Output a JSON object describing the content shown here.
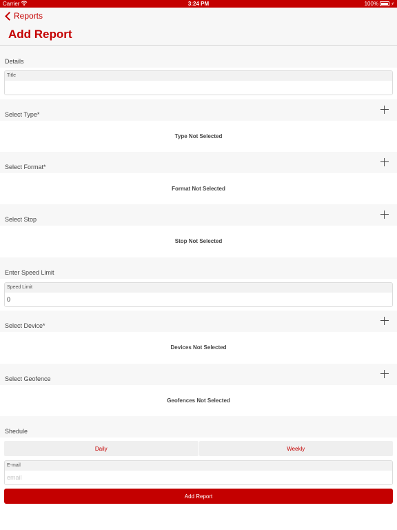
{
  "status_bar": {
    "carrier": "Carrier",
    "time": "3:24 PM",
    "battery": "100%"
  },
  "nav": {
    "back_label": "Reports",
    "title": "Add Report"
  },
  "details": {
    "header": "Details",
    "title_label": "Title",
    "title_value": ""
  },
  "type": {
    "header": "Select Type*",
    "empty": "Type Not Selected"
  },
  "format": {
    "header": "Select Format*",
    "empty": "Format Not Selected"
  },
  "stop": {
    "header": "Select Stop",
    "empty": "Stop Not Selected"
  },
  "speed": {
    "header": "Enter Speed Limit",
    "label": "Speed Limit",
    "value": "0"
  },
  "device": {
    "header": "Select Device*",
    "empty": "Devices Not Selected"
  },
  "geofence": {
    "header": "Select Geofence",
    "empty": "Geofences Not Selected"
  },
  "schedule": {
    "header": "Shedule",
    "daily": "Daily",
    "weekly": "Weekly"
  },
  "email": {
    "label": "E-mail",
    "placeholder": "email",
    "value": ""
  },
  "submit_label": "Add Report",
  "colors": {
    "accent": "#c40000",
    "section_bg": "#f7f7f7"
  }
}
